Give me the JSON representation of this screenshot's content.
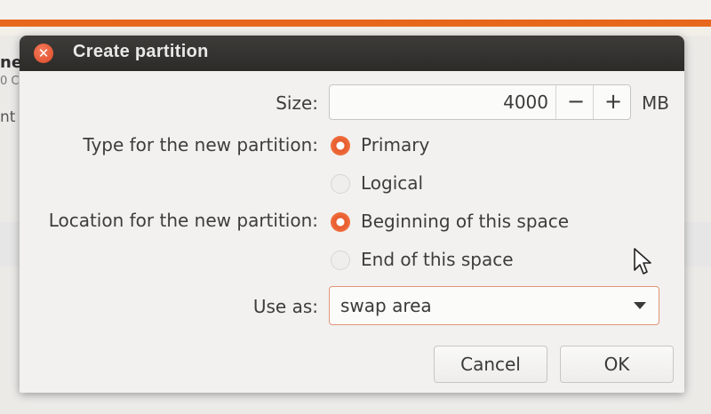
{
  "background": {
    "fragments": [
      "ne",
      "0 C",
      "nt"
    ]
  },
  "dialog": {
    "title": "Create partition",
    "close_icon": "close-icon",
    "size_label": "Size:",
    "size_value": "4000",
    "size_minus": "−",
    "size_plus": "+",
    "size_unit": "MB",
    "type_label": "Type for the new partition:",
    "type_options": [
      {
        "label": "Primary",
        "selected": true
      },
      {
        "label": "Logical",
        "selected": false
      }
    ],
    "location_label": "Location for the new partition:",
    "location_options": [
      {
        "label": "Beginning of this space",
        "selected": true
      },
      {
        "label": "End of this space",
        "selected": false
      }
    ],
    "use_as_label": "Use as:",
    "use_as_value": "swap area",
    "cancel_label": "Cancel",
    "ok_label": "OK"
  },
  "colors": {
    "accent": "#e65a2c",
    "titlebar": "#2c2b28"
  }
}
